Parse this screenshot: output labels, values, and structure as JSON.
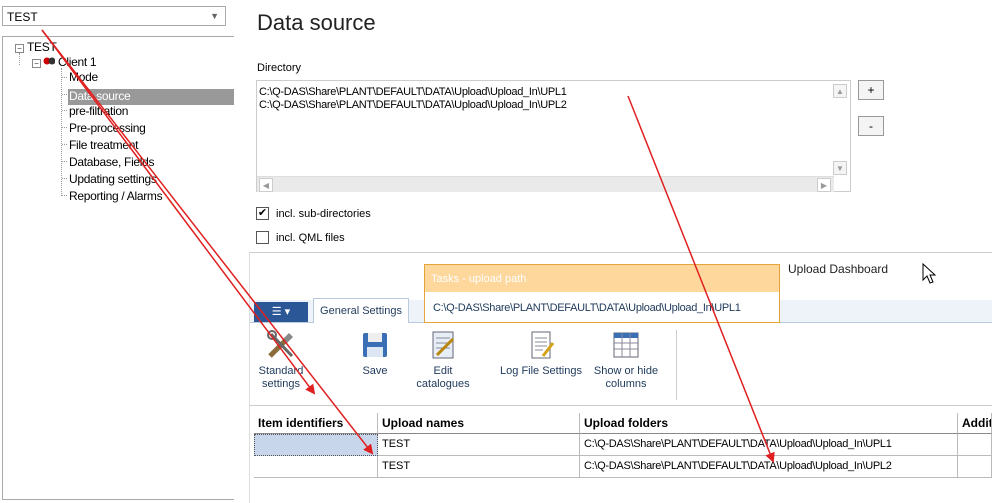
{
  "combo": {
    "value": "TEST"
  },
  "tree": {
    "root": "TEST",
    "client": "Client 1",
    "items": [
      "Mode",
      "Data source",
      "pre-filtration",
      "Pre-processing",
      "File treatment",
      "Database, Fields",
      "Updating settings",
      "Reporting / Alarms"
    ],
    "selected": "Data source"
  },
  "page": {
    "title": "Data source"
  },
  "directory": {
    "label": "Directory",
    "lines": [
      "C:\\Q-DAS\\Share\\PLANT\\DEFAULT\\DATA\\Upload\\Upload_In\\UPL1",
      "C:\\Q-DAS\\Share\\PLANT\\DEFAULT\\DATA\\Upload\\Upload_In\\UPL2"
    ],
    "add_label": "+",
    "remove_label": "-"
  },
  "options": {
    "subdirs_label": "incl. sub-directories",
    "subdirs_checked": true,
    "qml_label": "incl. QML files",
    "qml_checked": false
  },
  "dashboard": {
    "window_title": "Upload Dashboard",
    "context_tab": "Tasks - upload path",
    "tabs": {
      "general": "General Settings",
      "path": "C:\\Q-DAS\\Share\\PLANT\\DEFAULT\\DATA\\Upload\\Upload_In\\UPL1"
    },
    "toolbar": {
      "standard": "Standard settings",
      "save": "Save",
      "edit": "Edit catalogues",
      "log": "Log File Settings",
      "show_hide": "Show or hide columns"
    },
    "grid": {
      "headers": [
        "Item identifiers",
        "Upload names",
        "Upload folders",
        "Additi"
      ],
      "rows": [
        [
          "",
          "TEST",
          "C:\\Q-DAS\\Share\\PLANT\\DEFAULT\\DATA\\Upload\\Upload_In\\UPL1",
          ""
        ],
        [
          "",
          "TEST",
          "C:\\Q-DAS\\Share\\PLANT\\DEFAULT\\DATA\\Upload\\Upload_In\\UPL2",
          ""
        ]
      ]
    }
  },
  "colors": {
    "annotation_arrow": "#e02020",
    "tree_selected": "#999999",
    "context_tab": "#fdd79b",
    "app_button": "#2b5797"
  }
}
